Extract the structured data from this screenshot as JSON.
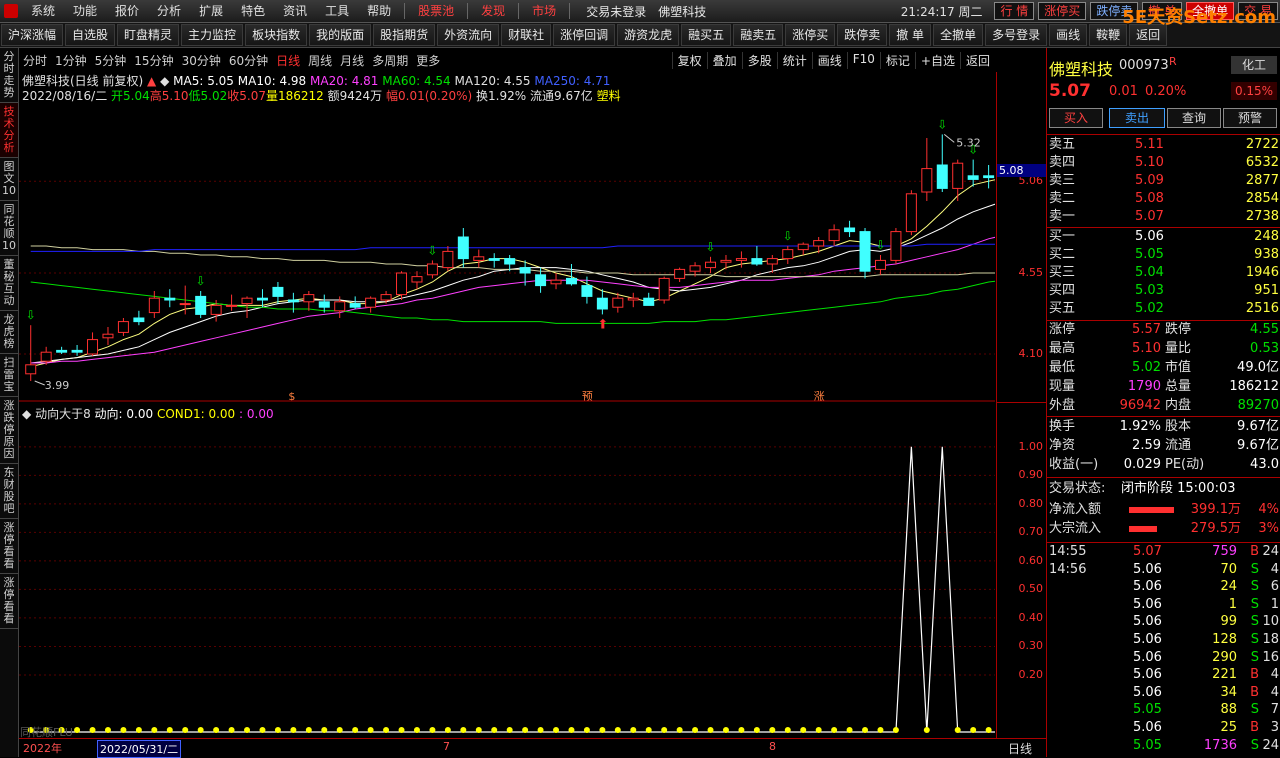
{
  "menu": {
    "items": [
      "系统",
      "功能",
      "报价",
      "分析",
      "扩展",
      "特色",
      "资讯",
      "工具",
      "帮助"
    ],
    "red_items": [
      "股票池",
      "发现",
      "市场"
    ],
    "login_status": "交易未登录",
    "stock_name": "佛塑科技",
    "time": "21:24:17 周二",
    "buttons": [
      "行 情",
      "涨停买",
      "跌停卖",
      "撤 单",
      "全撤单",
      "交 易"
    ],
    "watermark": "5E天资Setz.com"
  },
  "toolbar": [
    "沪深涨幅",
    "自选股",
    "盯盘精灵",
    "主力监控",
    "板块指数",
    "我的版面",
    "股指期货",
    "外资流向",
    "财联社",
    "涨停回调",
    "游资龙虎",
    "融买五",
    "融卖五",
    "涨停买",
    "跌停卖",
    "撤 单",
    "全撤单",
    "多号登录",
    "画线",
    "鞍鞭",
    "返回"
  ],
  "left_tabs": [
    "分时走势",
    "技术分析",
    "图文10",
    "同花顺10",
    "董秘互动",
    "龙虎榜",
    "扫雷宝",
    "涨跌停原因",
    "东财股吧",
    "涨停看看",
    "涨停看看"
  ],
  "period_bar": {
    "items": [
      "分时",
      "1分钟",
      "5分钟",
      "15分钟",
      "30分钟",
      "60分钟",
      "日线",
      "周线",
      "月线",
      "多周期",
      "更多"
    ],
    "active": "日线",
    "right": [
      "复权",
      "叠加",
      "多股",
      "统计",
      "画线",
      "F10",
      "标记",
      "+自选",
      "返回"
    ]
  },
  "header": {
    "title": "佛塑科技(日线 前复权)",
    "ma5": "MA5: 5.05",
    "ma10": "MA10: 4.98",
    "ma20": "MA20: 4.81",
    "ma60": "MA60: 4.54",
    "ma120": "MA120: 4.55",
    "ma250": "MA250: 4.71",
    "date": "2022/08/16/二",
    "open": "开5.04",
    "high": "高5.10",
    "low": "低5.02",
    "close": "收5.07",
    "vol": "量186212",
    "amount": "额9424万",
    "change": "幅0.01(0.20%)",
    "turnover": "换1.92%",
    "float": "流通9.67亿",
    "sector": "塑料"
  },
  "sub_header": {
    "name": "动向大于8",
    "l1": "动向: 0.00",
    "l2": "COND1: 0.00",
    "l3": ": 0.00",
    "watermark": "同花顺FLU"
  },
  "axis": {
    "main_ticks": [
      "5.06",
      "4.55",
      "4.10"
    ],
    "current": "5.08",
    "sub_ticks": [
      "1.00",
      "0.90",
      "0.80",
      "0.70",
      "0.60",
      "0.50",
      "0.40",
      "0.30",
      "0.20"
    ],
    "period": "日线",
    "dates": [
      "2022年",
      "2022/05/31/二",
      "7",
      "8"
    ],
    "annot_high": "5.32",
    "annot_low": "3.99",
    "markers": [
      "$",
      "预",
      "涨"
    ]
  },
  "chart_data": {
    "type": "candlestick",
    "title": "佛塑科技(日线 前复权)",
    "ylim": [
      3.9,
      5.5
    ],
    "candles": [
      [
        3.99,
        4.26,
        3.95,
        4.04
      ],
      [
        4.06,
        4.14,
        4.04,
        4.11
      ],
      [
        4.12,
        4.14,
        4.1,
        4.11
      ],
      [
        4.12,
        4.15,
        4.09,
        4.11
      ],
      [
        4.1,
        4.22,
        4.09,
        4.18
      ],
      [
        4.19,
        4.25,
        4.15,
        4.21
      ],
      [
        4.22,
        4.3,
        4.2,
        4.28
      ],
      [
        4.3,
        4.34,
        4.26,
        4.28
      ],
      [
        4.33,
        4.45,
        4.3,
        4.41
      ],
      [
        4.41,
        4.46,
        4.36,
        4.4
      ],
      [
        4.38,
        4.48,
        4.32,
        4.38
      ],
      [
        4.42,
        4.45,
        4.3,
        4.32
      ],
      [
        4.32,
        4.4,
        4.28,
        4.37
      ],
      [
        4.37,
        4.43,
        4.34,
        4.37
      ],
      [
        4.38,
        4.42,
        4.3,
        4.41
      ],
      [
        4.41,
        4.46,
        4.36,
        4.4
      ],
      [
        4.47,
        4.5,
        4.38,
        4.42
      ],
      [
        4.4,
        4.44,
        4.33,
        4.39
      ],
      [
        4.39,
        4.45,
        4.34,
        4.43
      ],
      [
        4.39,
        4.43,
        4.33,
        4.36
      ],
      [
        4.34,
        4.42,
        4.3,
        4.39
      ],
      [
        4.38,
        4.42,
        4.35,
        4.36
      ],
      [
        4.36,
        4.42,
        4.33,
        4.41
      ],
      [
        4.4,
        4.45,
        4.38,
        4.43
      ],
      [
        4.43,
        4.56,
        4.4,
        4.55
      ],
      [
        4.5,
        4.56,
        4.46,
        4.53
      ],
      [
        4.54,
        4.62,
        4.52,
        4.6
      ],
      [
        4.58,
        4.7,
        4.56,
        4.67
      ],
      [
        4.75,
        4.8,
        4.58,
        4.63
      ],
      [
        4.62,
        4.68,
        4.58,
        4.64
      ],
      [
        4.63,
        4.66,
        4.58,
        4.62
      ],
      [
        4.63,
        4.65,
        4.56,
        4.6
      ],
      [
        4.58,
        4.62,
        4.48,
        4.55
      ],
      [
        4.54,
        4.58,
        4.44,
        4.48
      ],
      [
        4.49,
        4.55,
        4.46,
        4.51
      ],
      [
        4.52,
        4.6,
        4.48,
        4.49
      ],
      [
        4.48,
        4.53,
        4.38,
        4.42
      ],
      [
        4.41,
        4.46,
        4.32,
        4.35
      ],
      [
        4.36,
        4.44,
        4.33,
        4.41
      ],
      [
        4.4,
        4.44,
        4.36,
        4.41
      ],
      [
        4.41,
        4.44,
        4.37,
        4.37
      ],
      [
        4.4,
        4.53,
        4.38,
        4.52
      ],
      [
        4.52,
        4.58,
        4.5,
        4.57
      ],
      [
        4.56,
        4.61,
        4.53,
        4.59
      ],
      [
        4.58,
        4.64,
        4.55,
        4.61
      ],
      [
        4.61,
        4.65,
        4.57,
        4.62
      ],
      [
        4.62,
        4.67,
        4.58,
        4.63
      ],
      [
        4.63,
        4.7,
        4.59,
        4.6
      ],
      [
        4.6,
        4.65,
        4.55,
        4.63
      ],
      [
        4.63,
        4.7,
        4.6,
        4.68
      ],
      [
        4.68,
        4.72,
        4.65,
        4.71
      ],
      [
        4.7,
        4.75,
        4.66,
        4.73
      ],
      [
        4.73,
        4.82,
        4.7,
        4.79
      ],
      [
        4.8,
        4.84,
        4.75,
        4.78
      ],
      [
        4.78,
        4.8,
        4.52,
        4.56
      ],
      [
        4.57,
        4.65,
        4.54,
        4.62
      ],
      [
        4.62,
        4.8,
        4.6,
        4.78
      ],
      [
        4.78,
        5.01,
        4.76,
        4.99
      ],
      [
        5.0,
        5.3,
        4.95,
        5.13
      ],
      [
        5.15,
        5.32,
        5.0,
        5.02
      ],
      [
        5.02,
        5.18,
        4.95,
        5.16
      ],
      [
        5.09,
        5.18,
        5.03,
        5.07
      ],
      [
        5.09,
        5.15,
        5.02,
        5.08
      ],
      [
        5.1,
        5.14,
        4.98,
        5.08
      ],
      [
        5.04,
        5.1,
        4.94,
        5.02
      ],
      [
        5.04,
        5.1,
        5.02,
        5.07
      ]
    ],
    "ma_series": [
      {
        "name": "MA5",
        "color": "#ffff80",
        "values": [
          4.03,
          4.05,
          4.07,
          4.08,
          4.11,
          4.14,
          4.18,
          4.21,
          4.27,
          4.32,
          4.35,
          4.36,
          4.38,
          4.37,
          4.37,
          4.37,
          4.39,
          4.4,
          4.41,
          4.4,
          4.4,
          4.38,
          4.38,
          4.39,
          4.43,
          4.46,
          4.5,
          4.56,
          4.6,
          4.61,
          4.63,
          4.63,
          4.61,
          4.58,
          4.55,
          4.53,
          4.49,
          4.45,
          4.43,
          4.41,
          4.39,
          4.41,
          4.45,
          4.49,
          4.53,
          4.58,
          4.6,
          4.61,
          4.62,
          4.63,
          4.65,
          4.67,
          4.7,
          4.73,
          4.72,
          4.7,
          4.7,
          4.74,
          4.81,
          4.89,
          4.98,
          5.04,
          5.06,
          5.08,
          5.07,
          5.05
        ]
      },
      {
        "name": "MA10",
        "color": "#ffffff",
        "values": [
          4.05,
          4.06,
          4.07,
          4.08,
          4.09,
          4.1,
          4.12,
          4.14,
          4.18,
          4.22,
          4.25,
          4.28,
          4.31,
          4.33,
          4.34,
          4.36,
          4.38,
          4.39,
          4.4,
          4.4,
          4.4,
          4.39,
          4.39,
          4.39,
          4.41,
          4.43,
          4.45,
          4.48,
          4.51,
          4.53,
          4.56,
          4.57,
          4.58,
          4.58,
          4.58,
          4.57,
          4.56,
          4.54,
          4.52,
          4.5,
          4.47,
          4.46,
          4.45,
          4.46,
          4.47,
          4.49,
          4.51,
          4.54,
          4.56,
          4.58,
          4.59,
          4.61,
          4.64,
          4.67,
          4.68,
          4.67,
          4.69,
          4.72,
          4.76,
          4.8,
          4.85,
          4.89,
          4.92,
          4.95,
          4.97,
          4.98
        ]
      },
      {
        "name": "MA20",
        "color": "#ff40ff",
        "values": [
          4.05,
          4.05,
          4.06,
          4.06,
          4.07,
          4.08,
          4.09,
          4.1,
          4.11,
          4.13,
          4.15,
          4.17,
          4.19,
          4.21,
          4.23,
          4.25,
          4.27,
          4.29,
          4.31,
          4.32,
          4.33,
          4.35,
          4.36,
          4.37,
          4.38,
          4.4,
          4.41,
          4.43,
          4.45,
          4.47,
          4.48,
          4.49,
          4.5,
          4.51,
          4.51,
          4.51,
          4.51,
          4.5,
          4.49,
          4.48,
          4.47,
          4.47,
          4.47,
          4.48,
          4.49,
          4.5,
          4.51,
          4.51,
          4.51,
          4.52,
          4.53,
          4.54,
          4.56,
          4.57,
          4.58,
          4.59,
          4.6,
          4.62,
          4.64,
          4.66,
          4.68,
          4.71,
          4.74,
          4.76,
          4.79,
          4.81
        ]
      },
      {
        "name": "MA60",
        "color": "#00e000",
        "values": [
          4.5,
          4.49,
          4.48,
          4.47,
          4.46,
          4.45,
          4.44,
          4.43,
          4.42,
          4.41,
          4.4,
          4.39,
          4.38,
          4.37,
          4.36,
          4.36,
          4.35,
          4.35,
          4.35,
          4.34,
          4.34,
          4.33,
          4.32,
          4.31,
          4.3,
          4.3,
          4.29,
          4.29,
          4.28,
          4.28,
          4.28,
          4.28,
          4.28,
          4.28,
          4.27,
          4.27,
          4.27,
          4.27,
          4.27,
          4.27,
          4.27,
          4.28,
          4.28,
          4.28,
          4.29,
          4.29,
          4.3,
          4.31,
          4.32,
          4.33,
          4.34,
          4.35,
          4.36,
          4.37,
          4.38,
          4.39,
          4.41,
          4.42,
          4.43,
          4.45,
          4.46,
          4.48,
          4.5,
          4.51,
          4.53,
          4.54
        ]
      },
      {
        "name": "MA120",
        "color": "#d0d0a0",
        "values": [
          4.7,
          4.7,
          4.69,
          4.69,
          4.68,
          4.68,
          4.68,
          4.67,
          4.67,
          4.66,
          4.66,
          4.65,
          4.65,
          4.64,
          4.64,
          4.63,
          4.63,
          4.62,
          4.62,
          4.62,
          4.61,
          4.61,
          4.61,
          4.6,
          4.6,
          4.59,
          4.59,
          4.58,
          4.58,
          4.58,
          4.57,
          4.57,
          4.57,
          4.56,
          4.56,
          4.56,
          4.55,
          4.55,
          4.55,
          4.54,
          4.54,
          4.54,
          4.54,
          4.54,
          4.54,
          4.53,
          4.53,
          4.53,
          4.53,
          4.53,
          4.53,
          4.53,
          4.53,
          4.53,
          4.53,
          4.54,
          4.54,
          4.54,
          4.54,
          4.54,
          4.54,
          4.55,
          4.55,
          4.55,
          4.55,
          4.55
        ]
      },
      {
        "name": "MA250",
        "color": "#2020ff",
        "values": [
          4.67,
          4.67,
          4.67,
          4.67,
          4.67,
          4.67,
          4.67,
          4.67,
          4.68,
          4.68,
          4.68,
          4.68,
          4.68,
          4.68,
          4.68,
          4.68,
          4.68,
          4.68,
          4.68,
          4.68,
          4.68,
          4.68,
          4.69,
          4.69,
          4.69,
          4.69,
          4.69,
          4.69,
          4.69,
          4.69,
          4.69,
          4.69,
          4.69,
          4.69,
          4.69,
          4.69,
          4.69,
          4.69,
          4.7,
          4.7,
          4.7,
          4.7,
          4.7,
          4.7,
          4.7,
          4.7,
          4.7,
          4.7,
          4.7,
          4.7,
          4.7,
          4.7,
          4.7,
          4.7,
          4.7,
          4.7,
          4.7,
          4.7,
          4.71,
          4.71,
          4.71,
          4.71,
          4.71,
          4.71,
          4.71,
          4.71
        ]
      }
    ],
    "sub_series": {
      "name": "动向",
      "ylim": [
        0,
        1.08
      ],
      "values": [
        0,
        0,
        0,
        0,
        0,
        0,
        0,
        0,
        0,
        0,
        0,
        0,
        0,
        0,
        0,
        0,
        0,
        0,
        0,
        0,
        0,
        0,
        0,
        0,
        0,
        0,
        0,
        0,
        0,
        0,
        0,
        0,
        0,
        0,
        0,
        0,
        0,
        0,
        0,
        0,
        0,
        0,
        0,
        0,
        0,
        0,
        0,
        0,
        0,
        0,
        0,
        0,
        0,
        0,
        0,
        0,
        0,
        1,
        0,
        1,
        0,
        0,
        0,
        0,
        0,
        0
      ]
    },
    "down_arrows": [
      0,
      11,
      26,
      44,
      49,
      55,
      59,
      61,
      64
    ],
    "up_arrows": [
      37
    ]
  },
  "quote": {
    "name": "佛塑科技",
    "code": "000973",
    "flag": "R",
    "sector": "化工",
    "sector_pct": "0.15%",
    "price": "5.07",
    "chg": "0.01",
    "pct": "0.20%",
    "buttons": [
      "买入",
      "卖出",
      "查询",
      "预警"
    ],
    "asks": [
      [
        "卖五",
        "5.11",
        "2722"
      ],
      [
        "卖四",
        "5.10",
        "6532"
      ],
      [
        "卖三",
        "5.09",
        "2877"
      ],
      [
        "卖二",
        "5.08",
        "2854"
      ],
      [
        "卖一",
        "5.07",
        "2738"
      ]
    ],
    "bids": [
      [
        "买一",
        "5.06",
        "248"
      ],
      [
        "买二",
        "5.05",
        "938"
      ],
      [
        "买三",
        "5.04",
        "1946"
      ],
      [
        "买四",
        "5.03",
        "951"
      ],
      [
        "买五",
        "5.02",
        "2516"
      ]
    ],
    "stats": [
      [
        "涨停",
        "5.57",
        "跌停",
        "4.55"
      ],
      [
        "最高",
        "5.10",
        "量比",
        "0.53"
      ],
      [
        "最低",
        "5.02",
        "市值",
        "49.0亿"
      ],
      [
        "现量",
        "1790",
        "总量",
        "186212"
      ],
      [
        "外盘",
        "96942",
        "内盘",
        "89270"
      ]
    ],
    "fin": [
      [
        "换手",
        "1.92%",
        "股本",
        "9.67亿"
      ],
      [
        "净资",
        "2.59",
        "流通",
        "9.67亿"
      ],
      [
        "收益(一)",
        "0.029",
        "PE(动)",
        "43.0"
      ]
    ],
    "status_label": "交易状态:",
    "status_value": "闭市阶段 15:00:03",
    "flows": [
      [
        "净流入额",
        "399.1万",
        "4%",
        0.8
      ],
      [
        "大宗流入",
        "279.5万",
        "3%",
        0.5
      ]
    ],
    "ticks": [
      [
        "14:55",
        "5.07",
        "759",
        "B",
        "24"
      ],
      [
        "14:56",
        "5.06",
        "70",
        "S",
        "4"
      ],
      [
        "",
        "5.06",
        "24",
        "S",
        "6"
      ],
      [
        "",
        "5.06",
        "1",
        "S",
        "1"
      ],
      [
        "",
        "5.06",
        "99",
        "S",
        "10"
      ],
      [
        "",
        "5.06",
        "128",
        "S",
        "18"
      ],
      [
        "",
        "5.06",
        "290",
        "S",
        "16"
      ],
      [
        "",
        "5.06",
        "221",
        "B",
        "4"
      ],
      [
        "",
        "5.06",
        "34",
        "B",
        "4"
      ],
      [
        "",
        "5.05",
        "88",
        "S",
        "7"
      ],
      [
        "",
        "5.06",
        "25",
        "B",
        "3"
      ],
      [
        "",
        "5.05",
        "1736",
        "S",
        "24"
      ]
    ]
  }
}
